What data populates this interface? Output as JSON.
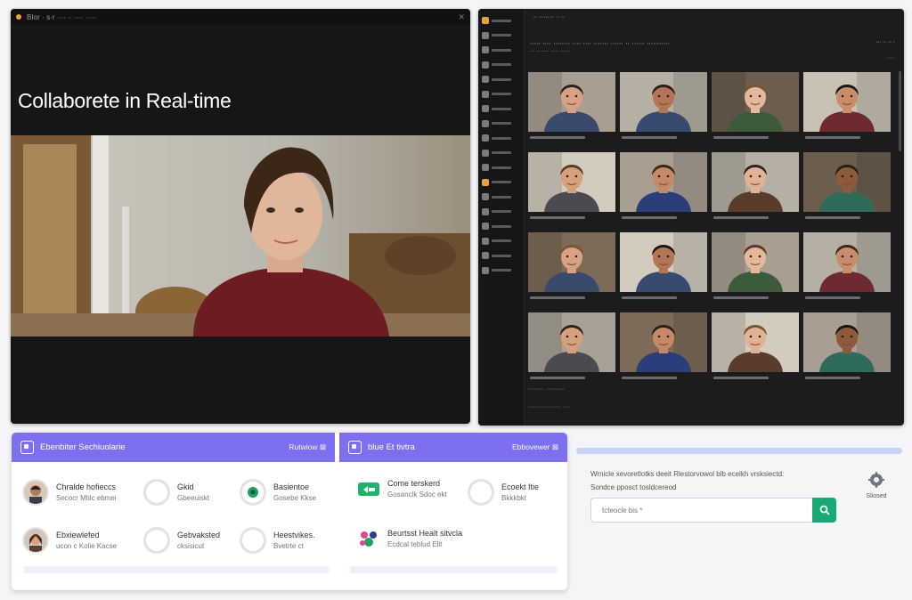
{
  "left_window": {
    "title": "Blor ∙ s∙r ∙∙∙∙ ∙∙ ∙∙∙∙ ∙∙∙∙∙",
    "heading": "Collaborete in Real-time"
  },
  "right_window": {
    "title": "∙∙ ∙∙∙∙∙∙∙∙∙ ∙∙ ∙∙",
    "toolbar_line": "∙∙∙∙∙ ∙∙∙∙ ∙∙∙∙∙∙∙∙ ∙∙∙∙ ∙∙∙∙ ∙∙∙∙∙∙∙ ∙∙∙∙∙∙ ∙∙ ∙∙∙∙∙∙ ∙∙∙∙∙∙∙∙∙∙∙",
    "toolbar_sub": "∙∙∙ ∙∙∙∙∙∙∙∙ ∙∙∙∙∙ ∙∙∙∙∙∙",
    "top_right_a": "∙∙∙ ∙∙  ∙∙ ∙",
    "top_right_b": "∙∙∙∙∙",
    "bottom_line_a": "∙∙∙∙∙∙∙∙∙ ∙∙∙∙∙∙∙∙∙∙∙",
    "bottom_line_b": "∙∙∙∙∙∙∙∙∙∙∙∙∙∙∙∙∙∙∙ ∙∙∙∙"
  },
  "bottom_panel": {
    "left_card": {
      "title": "Ebenbiter Sechiuolarie",
      "action": "Rutwiow ⊠",
      "users": [
        {
          "name": "Chralde hofieccs",
          "sub": "Secocr Mtilc ebmei"
        },
        {
          "name": "Gkid",
          "sub": "Gbeeuiskt"
        },
        {
          "name": "Basientoe",
          "sub": "Gosebe Kkse"
        },
        {
          "name": "Ebxiewlefed",
          "sub": "ucon c Kolie Kacse"
        },
        {
          "name": "Gebvaksted",
          "sub": "cksisicut"
        },
        {
          "name": "Heestvikes.",
          "sub": "Bvetrte ct"
        }
      ]
    },
    "right_card": {
      "title": "blue Et tivtra",
      "action": "Ebbovewer ⊠",
      "users": [
        {
          "name": "Come terskerd",
          "sub": "Gosanclk Sdoc ekt"
        },
        {
          "name": "Ecoekt Itie",
          "sub": "Bkkkbkt"
        },
        {
          "name": "Beurtsst Healt sitvcla",
          "sub": "Ecdcal teblud Elit"
        }
      ]
    }
  },
  "form": {
    "label_line1": "Wrnicle xevoretlotks deeit Rlestorvowol blb ecelkh vrsksiectd:",
    "label_line2": "Sondce pposct tosldcereod",
    "search_placeholder": "tcteocle bis *",
    "settings_label": "Sliosed"
  },
  "colors": {
    "accent_purple": "#7c6ff0",
    "search_green": "#19a974",
    "dark_window": "#161616"
  }
}
